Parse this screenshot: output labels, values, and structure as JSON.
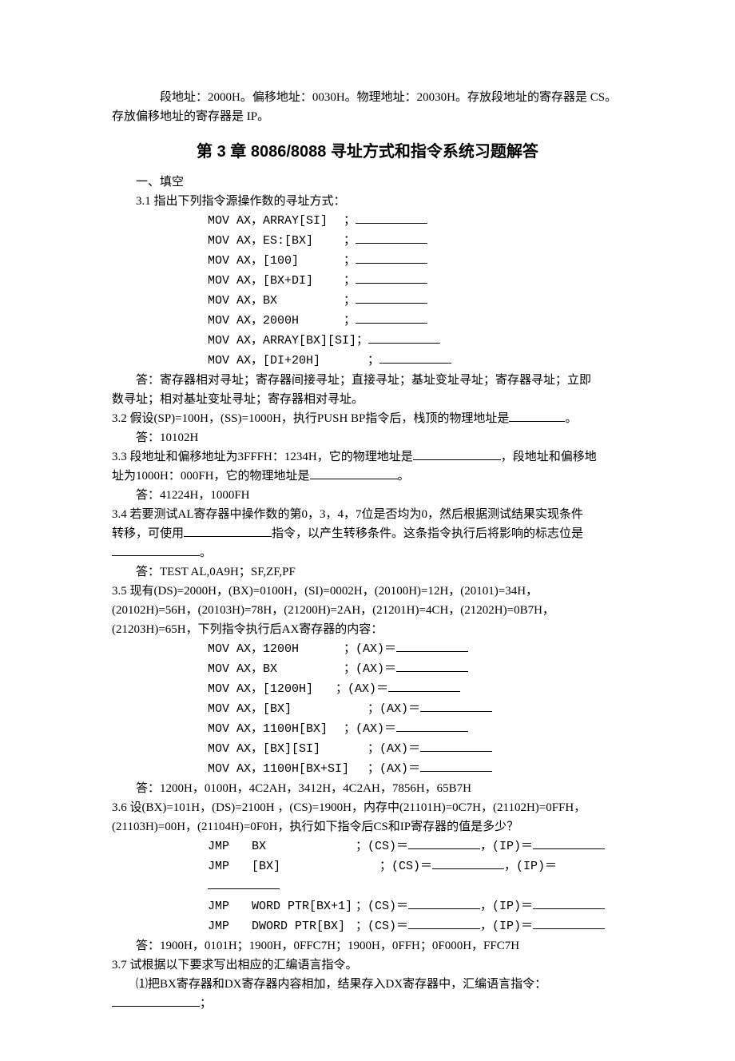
{
  "intro": {
    "line1_a": "段地址：2000H。偏移地址：0030H。物理地址：20030H。存放段地址的寄存器是 CS。",
    "line1_b": "存放偏移地址的寄存器是 IP。"
  },
  "chapter_title": "第 3 章 8086/8088 寻址方式和指令系统习题解答",
  "sec1_header": "一、填空",
  "q31": {
    "prompt": "3.1 指出下列指令源操作数的寻址方式：",
    "lines": [
      "MOV AX，ARRAY[SI]",
      "MOV AX，ES:[BX]",
      "MOV AX，[100]",
      "MOV AX，[BX+DI]",
      "MOV AX，BX",
      "MOV AX，2000H",
      "MOV AX，ARRAY[BX][SI]",
      "MOV AX，[DI+20H]"
    ],
    "semicolon": "；",
    "ans_a": "答：寄存器相对寻址；寄存器间接寻址；直接寻址；基址变址寻址；寄存器寻址；立即",
    "ans_b": "数寻址；相对基址变址寻址；寄存器相对寻址。"
  },
  "q32": {
    "prompt_a": "3.2 假设(SP)=100H，(SS)=1000H，执行PUSH BP指令后，栈顶的物理地址是",
    "prompt_b": "。",
    "ans": "答：10102H"
  },
  "q33": {
    "prompt_a": "3.3 段地址和偏移地址为3FFFH：1234H，它的物理地址是",
    "prompt_b": "，段地址和偏移地",
    "prompt_c": "址为1000H：000FH，它的物理地址是",
    "prompt_d": "。",
    "ans": "答：41224H，1000FH"
  },
  "q34": {
    "prompt_a": "3.4 若要测试AL寄存器中操作数的第0，3，4，7位是否均为0，然后根据测试结果实现条件",
    "prompt_b": "转移，可使用",
    "prompt_c": "指令，以产生转移条件。这条指令执行后将影响的标志位是",
    "prompt_d": "。",
    "ans": "答：TEST AL,0A9H；SF,ZF,PF"
  },
  "q35": {
    "line1": "3.5 现有(DS)=2000H，(BX)=0100H，(SI)=0002H，(20100H)=12H，(20101)=34H，",
    "line2": "(20102H)=56H，(20103H)=78H，(21200H)=2AH，(21201H)=4CH，(21202H)=0B7H，",
    "line3": "(21203H)=65H，下列指令执行后AX寄存器的内容：",
    "codes": [
      "MOV AX，1200H",
      "MOV AX，BX",
      "MOV AX，[1200H]",
      "MOV AX，[BX]",
      "MOV AX，1100H[BX]",
      "MOV AX，[BX][SI]",
      "MOV AX，1100H[BX+SI]"
    ],
    "ax_label": "；(AX)＝",
    "ans": "答：1200H，0100H，4C2AH，3412H，4C2AH，7856H，65B7H"
  },
  "q36": {
    "line1": "3.6 设(BX)=101H，(DS)=2100H ，(CS)=1900H，内存中(21101H)=0C7H，(21102H)=0FFH，",
    "line2": "(21103H)=00H，(21104H)=0F0H，执行如下指令后CS和IP寄存器的值是多少？",
    "rows": [
      {
        "inst": "JMP",
        "op": "BX"
      },
      {
        "inst": "JMP",
        "op": "[BX]"
      },
      {
        "inst": "JMP",
        "op": "WORD PTR[BX+1]"
      },
      {
        "inst": "JMP",
        "op": "DWORD PTR[BX]"
      }
    ],
    "cs_label": "；(CS)＝",
    "ip_label": "，(IP)＝",
    "ans": "答：1900H，0101H；1900H，0FFC7H；1900H，0FFH；0F000H，FFC7H"
  },
  "q37": {
    "line1": "3.7 试根据以下要求写出相应的汇编语言指令。",
    "sub1_a": "⑴把BX寄存器和DX寄存器内容相加，结果存入DX寄存器中，汇编语言指令：",
    "sub1_b": "；"
  }
}
